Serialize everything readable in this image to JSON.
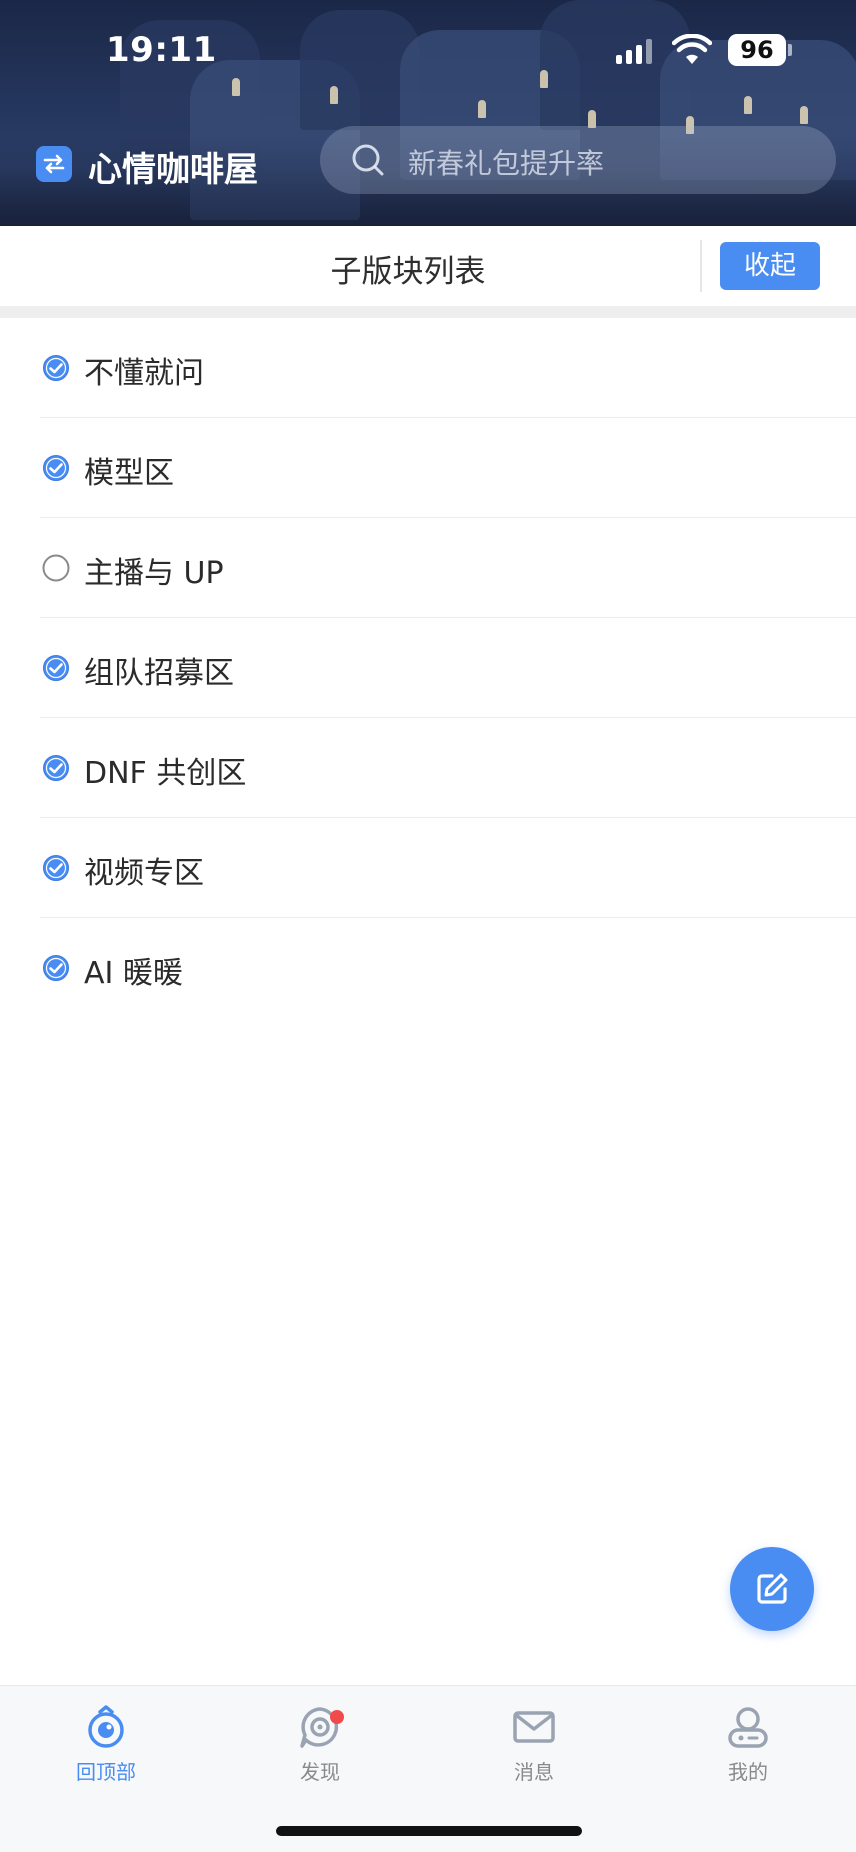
{
  "status_bar": {
    "time": "19:11",
    "battery": "96"
  },
  "header": {
    "app_title": "心情咖啡屋",
    "search_placeholder": "新春礼包提升率"
  },
  "subheader": {
    "title": "子版块列表",
    "collapse_label": "收起"
  },
  "list": {
    "items": [
      {
        "label": "不懂就问",
        "checked": true
      },
      {
        "label": "模型区",
        "checked": true
      },
      {
        "label": "主播与 UP",
        "checked": false
      },
      {
        "label": "组队招募区",
        "checked": true
      },
      {
        "label": "DNF 共创区",
        "checked": true
      },
      {
        "label": "视频专区",
        "checked": true
      },
      {
        "label": "AI 暖暖",
        "checked": true
      }
    ]
  },
  "tabbar": {
    "tabs": [
      {
        "label": "回顶部",
        "icon": "top-icon",
        "active": true
      },
      {
        "label": "发现",
        "icon": "discover-icon",
        "active": false,
        "badge": true
      },
      {
        "label": "消息",
        "icon": "mail-icon",
        "active": false
      },
      {
        "label": "我的",
        "icon": "profile-icon",
        "active": false
      }
    ]
  },
  "colors": {
    "accent": "#4a8df2",
    "badge": "#f24a4a",
    "header_bg": "#24355c"
  }
}
